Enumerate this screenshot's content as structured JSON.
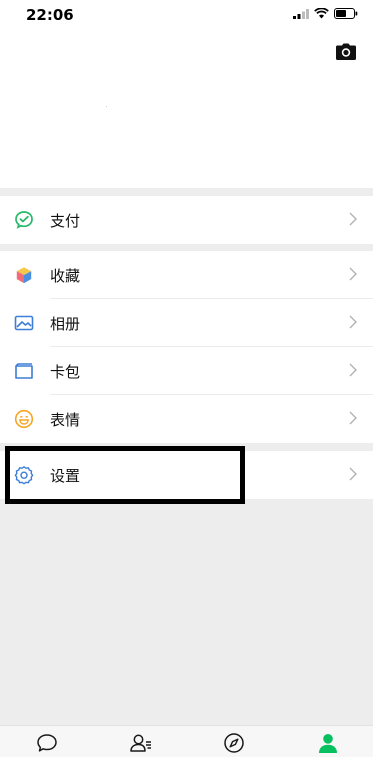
{
  "status_bar": {
    "time": "22:06"
  },
  "groups": {
    "pay": {
      "label": "支付"
    },
    "middle": [
      {
        "label": "收藏"
      },
      {
        "label": "相册"
      },
      {
        "label": "卡包"
      },
      {
        "label": "表情"
      }
    ],
    "settings": {
      "label": "设置"
    }
  },
  "colors": {
    "accent_green": "#07c160",
    "pay_green": "#29b86a",
    "blue_icon": "#3e7fd6",
    "yellow_icon": "#f5a623",
    "chevron": "#b2b2b2"
  },
  "tabbar": {
    "tabs": [
      {
        "name": "chats",
        "icon": "chat-bubble-icon",
        "active": false
      },
      {
        "name": "contacts",
        "icon": "contacts-icon",
        "active": false
      },
      {
        "name": "discover",
        "icon": "compass-icon",
        "active": false
      },
      {
        "name": "me",
        "icon": "person-icon",
        "active": true
      }
    ]
  }
}
